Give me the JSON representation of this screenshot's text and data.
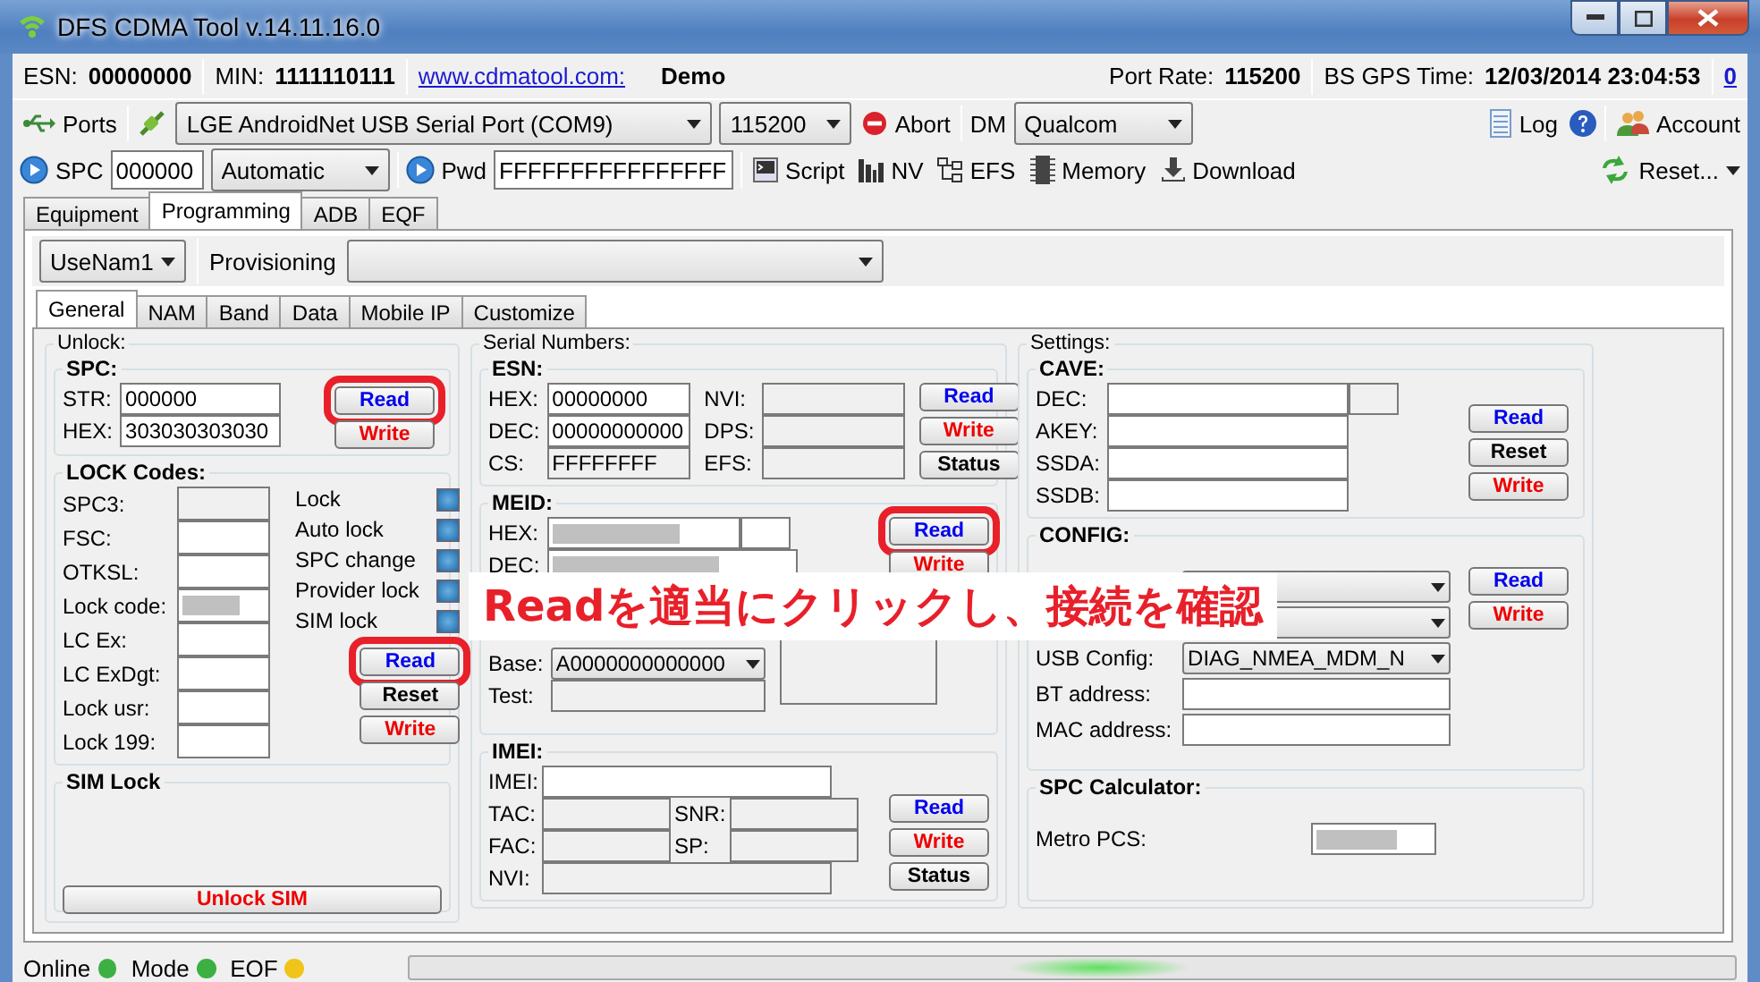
{
  "window": {
    "title": "DFS CDMA Tool v.14.11.16.0"
  },
  "info_bar": {
    "esn_label": "ESN:",
    "esn": "00000000",
    "min_label": "MIN:",
    "min": "1111110111",
    "link": "www.cdmatool.com:",
    "mode": "Demo",
    "port_rate_label": "Port Rate:",
    "port_rate": "115200",
    "gps_label": "BS GPS Time:",
    "gps_time": "12/03/2014 23:04:53",
    "counter": "0"
  },
  "connection_toolbar": {
    "ports": "Ports",
    "port": "LGE AndroidNet USB Serial Port (COM9)",
    "baud": "115200",
    "abort": "Abort",
    "dm_label": "DM",
    "dm": "Qualcom",
    "log": "Log",
    "account": "Account"
  },
  "spc_toolbar": {
    "spc_label": "SPC",
    "spc": "000000",
    "spc_mode": "Automatic",
    "pwd_label": "Pwd",
    "pwd": "FFFFFFFFFFFFFFFF",
    "tools": [
      {
        "label": "Script",
        "kind": "script"
      },
      {
        "label": "NV",
        "kind": "nv"
      },
      {
        "label": "EFS",
        "kind": "efs"
      },
      {
        "label": "Memory",
        "kind": "memory"
      },
      {
        "label": "Download",
        "kind": "download"
      }
    ],
    "reset": "Reset..."
  },
  "main_tabs": [
    {
      "label": "Equipment",
      "selected": false
    },
    {
      "label": "Programming",
      "selected": true
    },
    {
      "label": "ADB",
      "selected": false
    },
    {
      "label": "EQF",
      "selected": false
    }
  ],
  "nam": "UseNam1",
  "provisioning": "Provisioning",
  "sub_tabs": [
    {
      "label": "General",
      "selected": true
    },
    {
      "label": "NAM",
      "selected": false
    },
    {
      "label": "Band",
      "selected": false
    },
    {
      "label": "Data",
      "selected": false
    },
    {
      "label": "Mobile IP",
      "selected": false
    },
    {
      "label": "Customize",
      "selected": false
    }
  ],
  "unlock": {
    "title": "Unlock:",
    "spc": {
      "title": "SPC:",
      "fields": [
        {
          "label": "STR:",
          "value": "000000",
          "kind": "input"
        },
        {
          "label": "HEX:",
          "value": "303030303030",
          "kind": "input"
        }
      ],
      "buttons": [
        {
          "label": "Read",
          "kind": "read",
          "highlighted": true
        },
        {
          "label": "Write",
          "kind": "write",
          "highlighted": false
        }
      ]
    },
    "lock_codes": {
      "title": "LOCK Codes:",
      "fields": [
        {
          "label": "SPC3:",
          "kind": "readonly"
        },
        {
          "label": "FSC:",
          "kind": "input"
        },
        {
          "label": "OTKSL:",
          "kind": "input"
        },
        {
          "label": "Lock code:",
          "kind": "masked"
        },
        {
          "label": "LC Ex:",
          "kind": "input"
        },
        {
          "label": "LC ExDgt:",
          "kind": "input"
        },
        {
          "label": "Lock usr:",
          "kind": "input"
        },
        {
          "label": "Lock 199:",
          "kind": "input"
        }
      ],
      "indicators": [
        {
          "label": "Lock",
          "on": true
        },
        {
          "label": "Auto lock",
          "on": true
        },
        {
          "label": "SPC change",
          "on": true
        },
        {
          "label": "Provider lock",
          "on": true
        },
        {
          "label": "SIM lock",
          "on": true
        }
      ],
      "buttons": [
        {
          "label": "Read",
          "kind": "read",
          "highlighted": true
        },
        {
          "label": "Reset",
          "kind": "reset",
          "highlighted": false
        },
        {
          "label": "Write",
          "kind": "write",
          "highlighted": false
        }
      ]
    },
    "sim_lock": {
      "title": "SIM Lock",
      "button": {
        "label": "Unlock SIM",
        "kind": "write"
      }
    }
  },
  "serial": {
    "title": "Serial Numbers:",
    "esn": {
      "title": "ESN:",
      "fields": [
        {
          "label": "HEX:",
          "value": "00000000",
          "kind": "input"
        },
        {
          "label": "DEC:",
          "value": "00000000000",
          "kind": "input"
        },
        {
          "label": "CS:",
          "value": "FFFFFFFF",
          "kind": "readonly"
        }
      ],
      "fields_right": [
        {
          "label": "NVI:",
          "kind": "readonly"
        },
        {
          "label": "DPS:",
          "kind": "readonly"
        },
        {
          "label": "EFS:",
          "kind": "readonly"
        }
      ],
      "buttons": [
        {
          "label": "Read",
          "kind": "read",
          "highlighted": false
        },
        {
          "label": "Write",
          "kind": "write",
          "highlighted": false
        },
        {
          "label": "Status",
          "kind": "status",
          "highlighted": false
        }
      ]
    },
    "meid": {
      "title": "MEID:",
      "fields": [
        {
          "label": "HEX:",
          "kind": "masked",
          "addon": true
        },
        {
          "label": "DEC:",
          "kind": "masked"
        }
      ],
      "buttons": [
        {
          "label": "Read",
          "kind": "read",
          "highlighted": true
        },
        {
          "label": "Write",
          "kind": "write",
          "highlighted": false
        }
      ]
    },
    "prl": {
      "fields": [
        {
          "label": "Base:",
          "value": "A0000000000000",
          "kind": "select"
        },
        {
          "label": "Test:",
          "kind": "readonly"
        }
      ]
    },
    "imei": {
      "title": "IMEI:",
      "imei": {
        "label": "IMEI:",
        "kind": "input"
      },
      "pairs": [
        [
          {
            "label": "TAC:",
            "kind": "readonly"
          },
          {
            "label": "SNR:",
            "kind": "readonly"
          }
        ],
        [
          {
            "label": "FAC:",
            "kind": "readonly"
          },
          {
            "label": "SP:",
            "kind": "readonly"
          }
        ]
      ],
      "nvi": {
        "label": "NVI:",
        "kind": "readonly"
      },
      "buttons": [
        {
          "label": "Read",
          "kind": "read",
          "highlighted": false
        },
        {
          "label": "Write",
          "kind": "write",
          "highlighted": false
        },
        {
          "label": "Status",
          "kind": "status",
          "highlighted": false
        }
      ]
    }
  },
  "settings": {
    "title": "Settings:",
    "cave": {
      "title": "CAVE:",
      "fields": [
        {
          "label": "DEC:",
          "kind": "input",
          "addon": true
        },
        {
          "label": "AKEY:",
          "kind": "input"
        },
        {
          "label": "SSDA:",
          "kind": "input"
        },
        {
          "label": "SSDB:",
          "kind": "input"
        }
      ],
      "buttons": [
        {
          "label": "Read",
          "kind": "read",
          "highlighted": false
        },
        {
          "label": "Reset",
          "kind": "reset",
          "highlighted": false
        },
        {
          "label": "Write",
          "kind": "write",
          "highlighted": false
        }
      ]
    },
    "config": {
      "title": "CONFIG:",
      "fields": [
        {
          "kind": "select"
        },
        {
          "kind": "select"
        },
        {
          "label": "USB Config:",
          "value": "DIAG_NMEA_MDM_N",
          "kind": "select"
        },
        {
          "label": "BT address:",
          "kind": "input"
        },
        {
          "label": "MAC address:",
          "kind": "input"
        }
      ],
      "buttons": [
        {
          "label": "Read",
          "kind": "read",
          "highlighted": false
        },
        {
          "label": "Write",
          "kind": "write",
          "highlighted": false
        }
      ]
    },
    "spc_calculator": {
      "title": "SPC Calculator:",
      "fields": [
        {
          "label": "Metro PCS:",
          "kind": "masked"
        }
      ]
    }
  },
  "annotation": {
    "text": "Readを適当にクリックし、接続を確認"
  },
  "status_bar": {
    "items": [
      {
        "label": "Online",
        "color": "#3cb043"
      },
      {
        "label": "Mode",
        "color": "#3cb043"
      },
      {
        "label": "EOF",
        "color": "#f0c419"
      }
    ]
  }
}
